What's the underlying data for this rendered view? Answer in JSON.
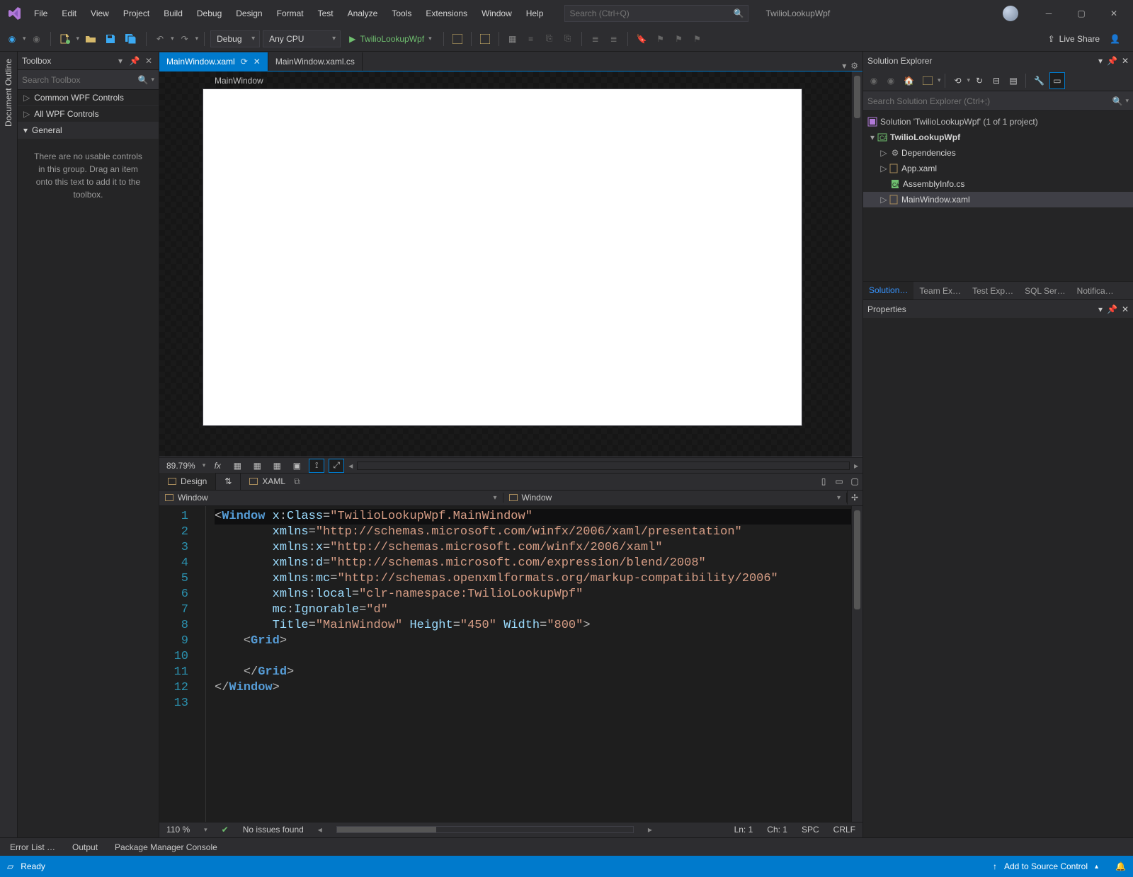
{
  "title_project": "TwilioLookupWpf",
  "search_placeholder": "Search (Ctrl+Q)",
  "menu": [
    "File",
    "Edit",
    "View",
    "Project",
    "Build",
    "Debug",
    "Design",
    "Format",
    "Test",
    "Analyze",
    "Tools",
    "Extensions",
    "Window",
    "Help"
  ],
  "toolbar": {
    "config": "Debug",
    "platform": "Any CPU",
    "run_label": "TwilioLookupWpf",
    "live_share": "Live Share"
  },
  "doc_outline": "Document Outline",
  "toolbox": {
    "title": "Toolbox",
    "search_placeholder": "Search Toolbox",
    "groups": [
      "Common WPF Controls",
      "All WPF Controls",
      "General"
    ],
    "empty_msg": "There are no usable controls in this group. Drag an item onto this text to add it to the toolbox."
  },
  "file_tabs": {
    "active": "MainWindow.xaml",
    "other": "MainWindow.xaml.cs"
  },
  "designer": {
    "artboard_label": "MainWindow",
    "zoom": "89.79%"
  },
  "dx_tabs": {
    "design": "Design",
    "xaml": "XAML"
  },
  "combo": {
    "left": "Window",
    "right": "Window"
  },
  "code": {
    "lines": [
      {
        "n": 1,
        "html": "<span class='c-punc'>&lt;</span><span class='c-tag'>Window</span> <span class='c-attr'>x</span><span class='c-punc'>:</span><span class='c-attr'>Class</span><span class='c-punc'>=</span><span class='c-str'>\"TwilioLookupWpf.MainWindow\"</span>"
      },
      {
        "n": 2,
        "html": "        <span class='c-attr'>xmlns</span><span class='c-punc'>=</span><span class='c-str'>\"http://schemas.microsoft.com/winfx/2006/xaml/presentation\"</span>"
      },
      {
        "n": 3,
        "html": "        <span class='c-attr'>xmlns</span><span class='c-punc'>:</span><span class='c-ns'>x</span><span class='c-punc'>=</span><span class='c-str'>\"http://schemas.microsoft.com/winfx/2006/xaml\"</span>"
      },
      {
        "n": 4,
        "html": "        <span class='c-attr'>xmlns</span><span class='c-punc'>:</span><span class='c-ns'>d</span><span class='c-punc'>=</span><span class='c-str'>\"http://schemas.microsoft.com/expression/blend/2008\"</span>"
      },
      {
        "n": 5,
        "html": "        <span class='c-attr'>xmlns</span><span class='c-punc'>:</span><span class='c-ns'>mc</span><span class='c-punc'>=</span><span class='c-str'>\"http://schemas.openxmlformats.org/markup-compatibility/2006\"</span>"
      },
      {
        "n": 6,
        "html": "        <span class='c-attr'>xmlns</span><span class='c-punc'>:</span><span class='c-ns'>local</span><span class='c-punc'>=</span><span class='c-str'>\"clr-namespace:TwilioLookupWpf\"</span>"
      },
      {
        "n": 7,
        "html": "        <span class='c-attr'>mc</span><span class='c-punc'>:</span><span class='c-attr'>Ignorable</span><span class='c-punc'>=</span><span class='c-str'>\"d\"</span>"
      },
      {
        "n": 8,
        "html": "        <span class='c-attr'>Title</span><span class='c-punc'>=</span><span class='c-str'>\"MainWindow\"</span> <span class='c-attr'>Height</span><span class='c-punc'>=</span><span class='c-str'>\"450\"</span> <span class='c-attr'>Width</span><span class='c-punc'>=</span><span class='c-str'>\"800\"</span><span class='c-punc'>&gt;</span>"
      },
      {
        "n": 9,
        "html": "    <span class='c-punc'>&lt;</span><span class='c-tag'>Grid</span><span class='c-punc'>&gt;</span>"
      },
      {
        "n": 10,
        "html": "        "
      },
      {
        "n": 11,
        "html": "    <span class='c-punc'>&lt;/</span><span class='c-tag'>Grid</span><span class='c-punc'>&gt;</span>"
      },
      {
        "n": 12,
        "html": "<span class='c-punc'>&lt;/</span><span class='c-tag'>Window</span><span class='c-punc'>&gt;</span>"
      },
      {
        "n": 13,
        "html": ""
      }
    ]
  },
  "code_status": {
    "zoom": "110 %",
    "issues": "No issues found",
    "ln": "Ln: 1",
    "ch": "Ch: 1",
    "spc": "SPC",
    "crlf": "CRLF"
  },
  "solution": {
    "title": "Solution Explorer",
    "search_placeholder": "Search Solution Explorer (Ctrl+;)",
    "root": "Solution 'TwilioLookupWpf' (1 of 1 project)",
    "project": "TwilioLookupWpf",
    "deps": "Dependencies",
    "appxaml": "App.xaml",
    "asm": "AssemblyInfo.cs",
    "mainxaml": "MainWindow.xaml",
    "tabs": [
      "Solution…",
      "Team Ex…",
      "Test Exp…",
      "SQL Ser…",
      "Notifica…"
    ]
  },
  "properties": {
    "title": "Properties"
  },
  "dock_tabs": [
    "Error List …",
    "Output",
    "Package Manager Console"
  ],
  "statusbar": {
    "ready": "Ready",
    "add_src": "Add to Source Control"
  }
}
